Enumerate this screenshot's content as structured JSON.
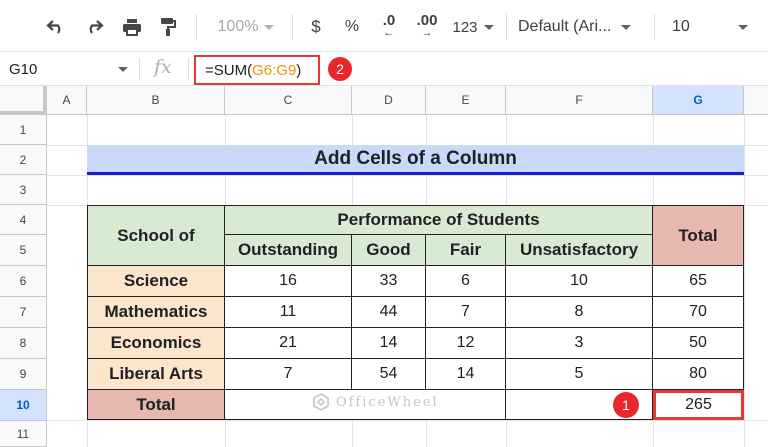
{
  "toolbar": {
    "zoom": "100%",
    "currency": "$",
    "percent": "%",
    "decrease_decimal": ".0",
    "increase_decimal": ".00",
    "number_format": "123",
    "font_family": "Default (Ari...",
    "font_size": "10",
    "icons": [
      "undo-icon",
      "redo-icon",
      "print-icon",
      "paint-format-icon"
    ]
  },
  "formula_bar": {
    "name_box": "G10",
    "fx_label": "fx",
    "formula_prefix": "=SUM(",
    "formula_ref": "G6:G9",
    "formula_suffix": ")",
    "badge": "2"
  },
  "columns": [
    "A",
    "B",
    "C",
    "D",
    "E",
    "F",
    "G"
  ],
  "rows": [
    "1",
    "2",
    "3",
    "4",
    "5",
    "6",
    "7",
    "8",
    "9",
    "10",
    "11"
  ],
  "title": "Add Cells of a Column",
  "table": {
    "school_header": "School of",
    "perf_header": "Performance of Students",
    "total_header": "Total",
    "sub_headers": [
      "Outstanding",
      "Good",
      "Fair",
      "Unsatisfactory"
    ],
    "data_rows": [
      {
        "label": "Science",
        "values": [
          "16",
          "33",
          "6",
          "10"
        ],
        "total": "65"
      },
      {
        "label": "Mathematics",
        "values": [
          "11",
          "44",
          "7",
          "8"
        ],
        "total": "70"
      },
      {
        "label": "Economics",
        "values": [
          "21",
          "14",
          "12",
          "3"
        ],
        "total": "50"
      },
      {
        "label": "Liberal Arts",
        "values": [
          "7",
          "54",
          "14",
          "5"
        ],
        "total": "80"
      }
    ],
    "total_row_label": "Total",
    "grand_total": "265",
    "badge": "1"
  },
  "watermark": "OfficeWheel",
  "colors": {
    "title_bg": "#c9daf8",
    "title_underline": "#1c1cd4",
    "perf_header_bg": "#d9ead3",
    "total_header_bg": "#e6b8af",
    "subject_bg": "#fce5cd",
    "highlight": "#e53935"
  }
}
